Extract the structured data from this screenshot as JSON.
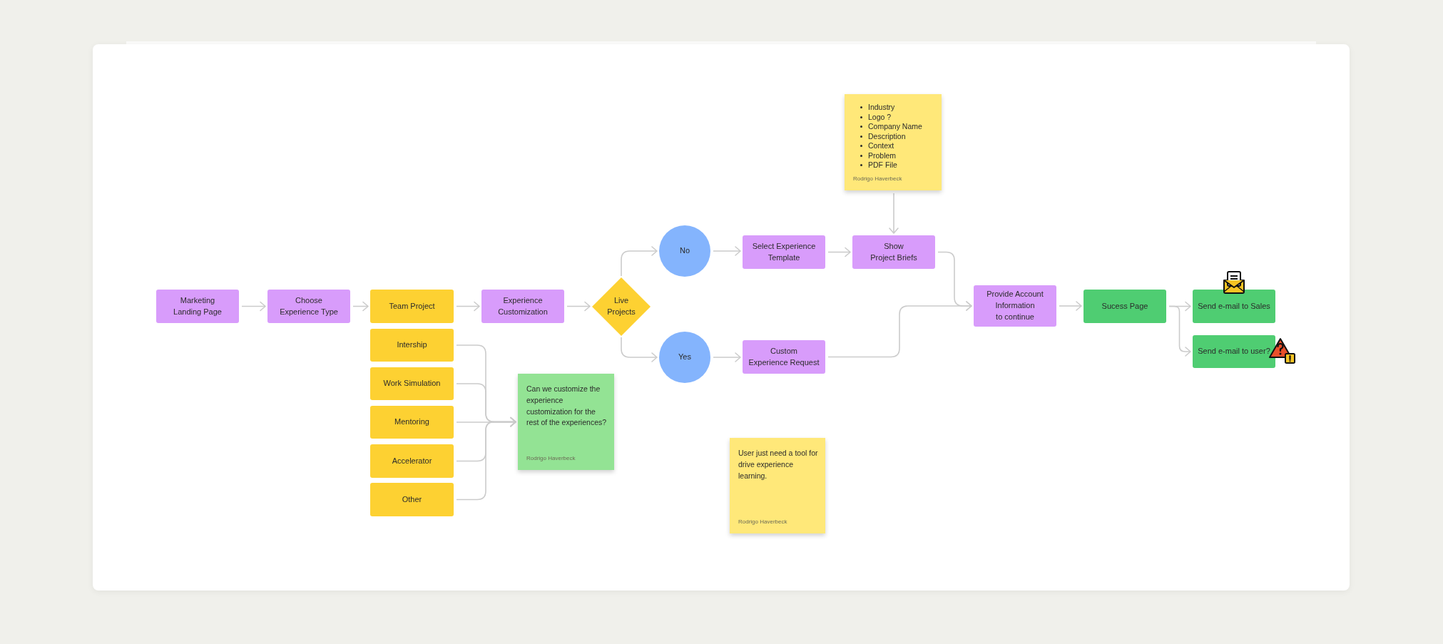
{
  "nodes": [
    {
      "kind": "process",
      "text": "Marketing\nLanding Page"
    },
    {
      "kind": "process",
      "text": "Choose\nExperience Type"
    },
    {
      "kind": "option",
      "text": "Team Project"
    },
    {
      "kind": "option",
      "text": "Intership"
    },
    {
      "kind": "option",
      "text": "Work Simulation"
    },
    {
      "kind": "option",
      "text": "Mentoring"
    },
    {
      "kind": "option",
      "text": "Accelerator"
    },
    {
      "kind": "option",
      "text": "Other"
    },
    {
      "kind": "process",
      "text": "Experience\nCustomization"
    },
    {
      "kind": "decision",
      "text": "Live\nProjects"
    },
    {
      "kind": "answer",
      "text": "No"
    },
    {
      "kind": "answer",
      "text": "Yes"
    },
    {
      "kind": "process",
      "text": "Select Experience\nTemplate"
    },
    {
      "kind": "process",
      "text": "Show\nProject Briefs"
    },
    {
      "kind": "process",
      "text": "Custom\nExperience Request"
    },
    {
      "kind": "process",
      "text": "Provide Account\nInformation\nto continue"
    },
    {
      "kind": "success",
      "text": "Sucess Page"
    },
    {
      "kind": "success",
      "text": "Send e-mail to Sales"
    },
    {
      "kind": "success",
      "text": "Send e-mail to user?"
    }
  ],
  "notes": [
    {
      "kind": "list",
      "color": "#ffe879",
      "items": [
        "Industry",
        "Logo ?",
        "Company Name",
        "Description",
        "Context",
        "Problem",
        "PDF File"
      ],
      "author": "Rodrigo Haverbeck"
    },
    {
      "kind": "text",
      "color": "#93e394",
      "text": "Can we customize the experience customization for the rest of the experiences?",
      "author": "Rodrigo Haverbeck"
    },
    {
      "kind": "text",
      "color": "#ffe879",
      "text": "User just need a tool for drive experience learning.",
      "author": "Rodrigo Haverbeck"
    }
  ]
}
